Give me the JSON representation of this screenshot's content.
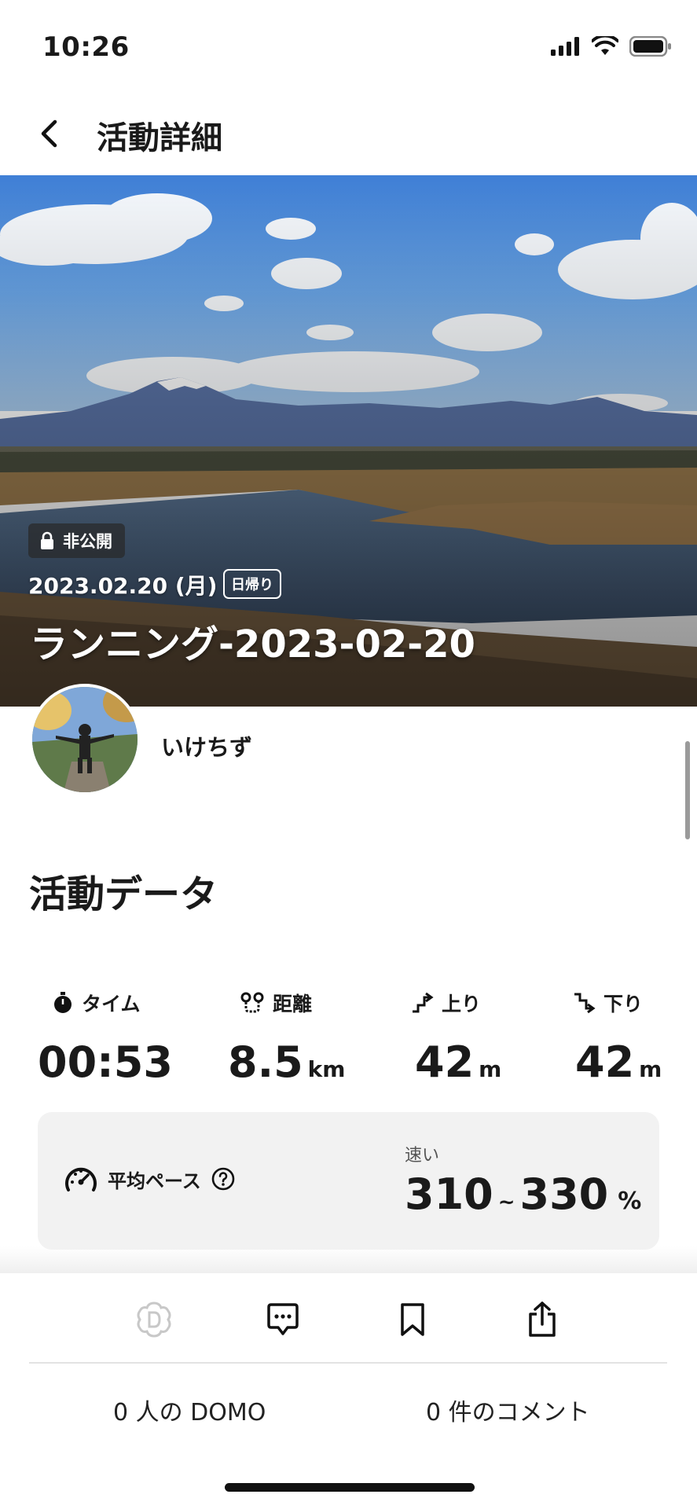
{
  "status_bar": {
    "time": "10:26",
    "icons": [
      "cellular-signal-icon",
      "wifi-icon",
      "battery-icon"
    ]
  },
  "header": {
    "title": "活動詳細",
    "back_icon": "chevron-left-icon"
  },
  "hero": {
    "visibility": "非公開",
    "date": "2023.02.20 (月)",
    "trip_type": "日帰り",
    "activity_name": "ランニング-2023-02-20"
  },
  "user": {
    "name": "いけちず"
  },
  "activity_data": {
    "section_title": "活動データ",
    "stats": [
      {
        "label": "タイム",
        "value": "00:53",
        "unit": "",
        "icon": "stopwatch-icon"
      },
      {
        "label": "距離",
        "value": "8.5",
        "unit": "km",
        "icon": "route-pin-icon"
      },
      {
        "label": "上り",
        "value": "42",
        "unit": "m",
        "icon": "ascent-icon"
      },
      {
        "label": "下り",
        "value": "42",
        "unit": "m",
        "icon": "descent-icon"
      }
    ],
    "pace": {
      "label": "平均ペース",
      "speed_label": "速い",
      "value_low": "310",
      "separator": "~",
      "value_high": "330",
      "unit": "%"
    }
  },
  "bottom_bar": {
    "actions": [
      "domo-icon",
      "comment-icon",
      "bookmark-icon",
      "share-icon"
    ],
    "domo_count": "0 人の DOMO",
    "comment_count": "0 件のコメント"
  },
  "colors": {
    "text": "#1a1a1a",
    "card": "#f2f2f2",
    "domo_inactive": "#c8c8c8"
  }
}
